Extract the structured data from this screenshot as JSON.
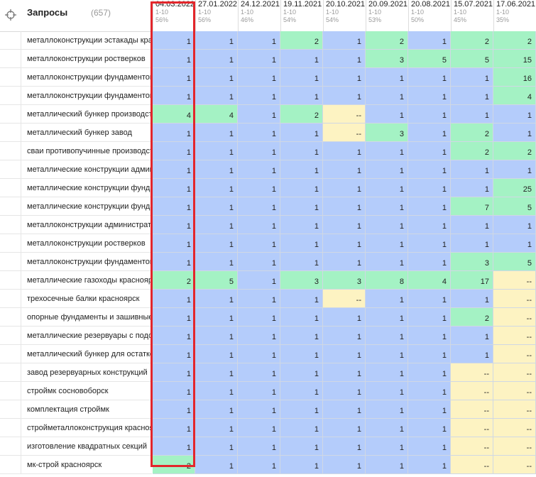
{
  "header": {
    "title": "Запросы",
    "count": "(657)",
    "icon": "target-icon"
  },
  "columns": [
    {
      "date": "04.03.2022",
      "range": "1-10",
      "pct": "56%"
    },
    {
      "date": "27.01.2022",
      "range": "1-10",
      "pct": "56%"
    },
    {
      "date": "24.12.2021",
      "range": "1-10",
      "pct": "46%"
    },
    {
      "date": "19.11.2021",
      "range": "1-10",
      "pct": "54%"
    },
    {
      "date": "20.10.2021",
      "range": "1-10",
      "pct": "54%"
    },
    {
      "date": "20.09.2021",
      "range": "1-10",
      "pct": "53%"
    },
    {
      "date": "20.08.2021",
      "range": "1-10",
      "pct": "50%"
    },
    {
      "date": "15.07.2021",
      "range": "1-10",
      "pct": "45%"
    },
    {
      "date": "17.06.2021",
      "range": "1-10",
      "pct": "35%"
    }
  ],
  "rows": [
    {
      "query": "металлоконструкции эстакады красноярск",
      "values": [
        "1",
        "1",
        "1",
        "2",
        "1",
        "2",
        "1",
        "2",
        "2"
      ]
    },
    {
      "query": "металлоконструкции ростверков",
      "values": [
        "1",
        "1",
        "1",
        "1",
        "1",
        "3",
        "5",
        "5",
        "15"
      ]
    },
    {
      "query": "металлоконструкции фундаментов",
      "values": [
        "1",
        "1",
        "1",
        "1",
        "1",
        "1",
        "1",
        "1",
        "16"
      ]
    },
    {
      "query": "металлоконструкции фундаментов",
      "values": [
        "1",
        "1",
        "1",
        "1",
        "1",
        "1",
        "1",
        "1",
        "4"
      ]
    },
    {
      "query": "металлический бункер производство",
      "values": [
        "4",
        "4",
        "1",
        "2",
        "--",
        "1",
        "1",
        "1",
        "1"
      ]
    },
    {
      "query": "металлический бункер завод",
      "values": [
        "1",
        "1",
        "1",
        "1",
        "--",
        "3",
        "1",
        "2",
        "1"
      ]
    },
    {
      "query": "сваи противопучинные производство",
      "values": [
        "1",
        "1",
        "1",
        "1",
        "1",
        "1",
        "1",
        "2",
        "2"
      ]
    },
    {
      "query": "металлические конструкции административных",
      "values": [
        "1",
        "1",
        "1",
        "1",
        "1",
        "1",
        "1",
        "1",
        "1"
      ]
    },
    {
      "query": "металлические конструкции фундаментов",
      "values": [
        "1",
        "1",
        "1",
        "1",
        "1",
        "1",
        "1",
        "1",
        "25"
      ]
    },
    {
      "query": "металлические конструкции фундаментов",
      "values": [
        "1",
        "1",
        "1",
        "1",
        "1",
        "1",
        "1",
        "7",
        "5"
      ]
    },
    {
      "query": "металлоконструкции административных",
      "values": [
        "1",
        "1",
        "1",
        "1",
        "1",
        "1",
        "1",
        "1",
        "1"
      ]
    },
    {
      "query": "металлоконструкции ростверков",
      "values": [
        "1",
        "1",
        "1",
        "1",
        "1",
        "1",
        "1",
        "1",
        "1"
      ]
    },
    {
      "query": "металлоконструкции фундаментов",
      "values": [
        "1",
        "1",
        "1",
        "1",
        "1",
        "1",
        "1",
        "3",
        "5"
      ]
    },
    {
      "query": "металлические газоходы красноярск",
      "values": [
        "2",
        "5",
        "1",
        "3",
        "3",
        "8",
        "4",
        "17",
        "--"
      ]
    },
    {
      "query": "трехосечные балки красноярск",
      "values": [
        "1",
        "1",
        "1",
        "1",
        "--",
        "1",
        "1",
        "1",
        "--"
      ]
    },
    {
      "query": "опорные фундаменты и зашивные",
      "values": [
        "1",
        "1",
        "1",
        "1",
        "1",
        "1",
        "1",
        "2",
        "--"
      ]
    },
    {
      "query": "металлические резервуары с подогревом",
      "values": [
        "1",
        "1",
        "1",
        "1",
        "1",
        "1",
        "1",
        "1",
        "--"
      ]
    },
    {
      "query": "металлический бункер для остатков",
      "values": [
        "1",
        "1",
        "1",
        "1",
        "1",
        "1",
        "1",
        "1",
        "--"
      ]
    },
    {
      "query": "завод резервуарных конструкций",
      "values": [
        "1",
        "1",
        "1",
        "1",
        "1",
        "1",
        "1",
        "--",
        "--"
      ]
    },
    {
      "query": "строймк сосновоборск",
      "values": [
        "1",
        "1",
        "1",
        "1",
        "1",
        "1",
        "1",
        "--",
        "--"
      ]
    },
    {
      "query": "комплектация строймк",
      "values": [
        "1",
        "1",
        "1",
        "1",
        "1",
        "1",
        "1",
        "--",
        "--"
      ]
    },
    {
      "query": "стройметаллоконструкция красноярск",
      "values": [
        "1",
        "1",
        "1",
        "1",
        "1",
        "1",
        "1",
        "--",
        "--"
      ]
    },
    {
      "query": "изготовление квадратных секций",
      "values": [
        "1",
        "1",
        "1",
        "1",
        "1",
        "1",
        "1",
        "--",
        "--"
      ]
    },
    {
      "query": "мк-строй красноярск",
      "values": [
        "2",
        "1",
        "1",
        "1",
        "1",
        "1",
        "1",
        "--",
        "--"
      ]
    }
  ],
  "colors": {
    "blue": "#b4ccfb",
    "green": "#a4f2c4",
    "yellow": "#fdf3c2",
    "highlight": "#e3262b"
  }
}
